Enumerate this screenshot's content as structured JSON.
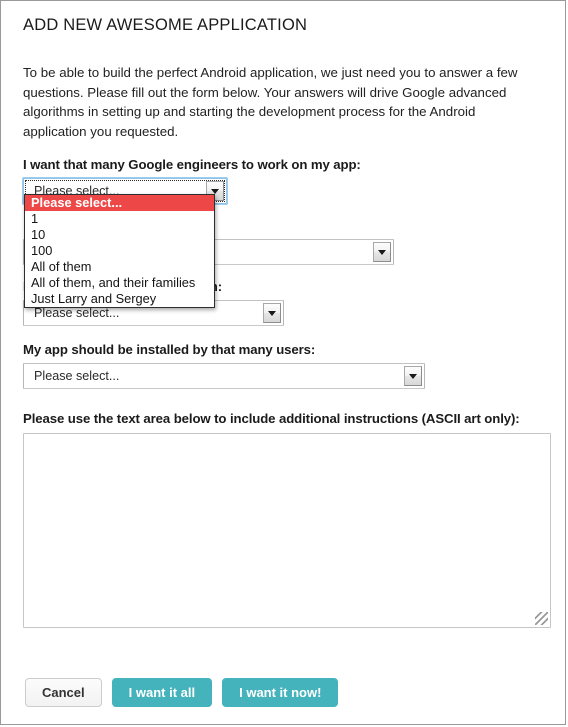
{
  "page": {
    "title": "ADD NEW AWESOME APPLICATION",
    "intro": "To be able to build the perfect Android application, we just need you to answer a few questions. Please fill out the form below. Your answers will drive Google advanced algorithms in setting up and starting the development process for the Android application you requested."
  },
  "colors": {
    "accent_teal": "#45b3bb",
    "highlight_red": "#ee4747",
    "border_gray": "#9a9a9a"
  },
  "fields": [
    {
      "label": "I want that many Google engineers to work on my app:",
      "value": "Please select...",
      "open": true,
      "options": [
        "Please select...",
        "1",
        "10",
        "100",
        "All of them",
        "All of them, and their families",
        "Just Larry and Sergey"
      ],
      "selected_option": "Please select..."
    },
    {
      "label": "",
      "value": "",
      "open": false
    },
    {
      "label": "I want my app to be featured on:",
      "value": "Please select...",
      "open": false
    },
    {
      "label": "My app should be installed by that many users:",
      "value": "Please select...",
      "open": false
    }
  ],
  "textarea": {
    "label": "Please use the text area below to include additional instructions (ASCII art only):",
    "value": "",
    "placeholder": ""
  },
  "buttons": {
    "cancel": "Cancel",
    "want_all": "I want it all",
    "want_now": "I want it now!"
  }
}
